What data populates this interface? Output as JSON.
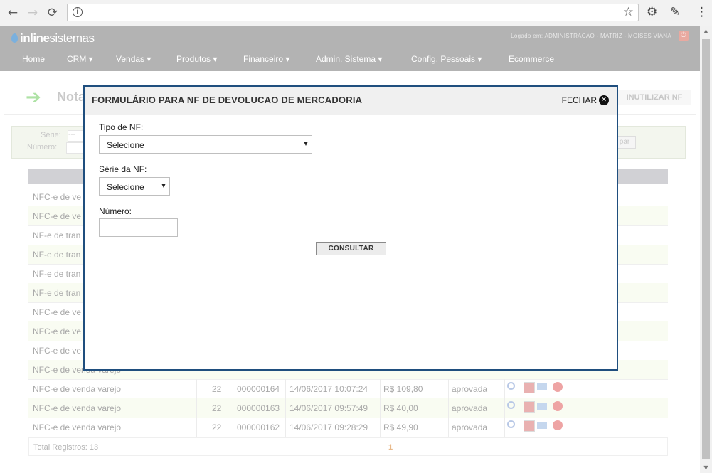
{
  "browser": {
    "back_glyph": "←",
    "forward_glyph": "→",
    "reload_glyph": "⟳",
    "info_glyph": "i",
    "star_glyph": "☆",
    "settings_glyph": "⚙",
    "extension_glyph": "✎",
    "menu_glyph": "⋮",
    "url": ""
  },
  "header": {
    "logo_prefix": "inline",
    "logo_suffix": "sistemas",
    "logged_text": "Logado em: ADMINISTRACAO - MATRIZ - MOISES VIANA",
    "power_glyph": "⏻",
    "menu": [
      {
        "label": "Home"
      },
      {
        "label": "CRM ▾"
      },
      {
        "label": "Vendas ▾"
      },
      {
        "label": "Produtos ▾"
      },
      {
        "label": "Financeiro ▾"
      },
      {
        "label": "Admin. Sistema ▾"
      },
      {
        "label": "Config. Pessoais ▾"
      },
      {
        "label": "Ecommerce"
      }
    ]
  },
  "page": {
    "arrow_glyph": "➔",
    "title": "Nota",
    "inutilizar_label": "INUTILIZAR NF",
    "filter": {
      "serie_label": "Série:",
      "serie_value": "---",
      "numero_label": "Número:",
      "limpar_label": "par"
    },
    "rows": [
      {
        "tipo": "NFC-e de ve"
      },
      {
        "tipo": "NFC-e de ve"
      },
      {
        "tipo": "NF-e de tran"
      },
      {
        "tipo": "NF-e de tran"
      },
      {
        "tipo": "NF-e de tran"
      },
      {
        "tipo": "NF-e de tran"
      },
      {
        "tipo": "NFC-e de ve"
      },
      {
        "tipo": "NFC-e de ve"
      },
      {
        "tipo": "NFC-e de ve"
      },
      {
        "tipo": "NFC-e de venda varejo"
      }
    ],
    "full_rows": [
      {
        "tipo": "NFC-e de venda varejo",
        "serie": "22",
        "numero": "000000164",
        "data": "14/06/2017 10:07:24",
        "valor": "R$ 109,80",
        "status": "aprovada"
      },
      {
        "tipo": "NFC-e de venda varejo",
        "serie": "22",
        "numero": "000000163",
        "data": "14/06/2017 09:57:49",
        "valor": "R$ 40,00",
        "status": "aprovada"
      },
      {
        "tipo": "NFC-e de venda varejo",
        "serie": "22",
        "numero": "000000162",
        "data": "14/06/2017 09:28:29",
        "valor": "R$ 49,90",
        "status": "aprovada"
      }
    ],
    "total_label": "Total Registros: 13",
    "current_page": "1"
  },
  "modal": {
    "title": "FORMULÁRIO PARA NF DE DEVOLUCAO DE MERCADORIA",
    "close_label": "FECHAR",
    "close_glyph": "✕",
    "tipo_label": "Tipo de NF:",
    "tipo_value": "Selecione",
    "serie_label": "Série da NF:",
    "serie_value": "Selecione",
    "numero_label": "Número:",
    "numero_value": "",
    "consultar_label": "CONSULTAR"
  }
}
